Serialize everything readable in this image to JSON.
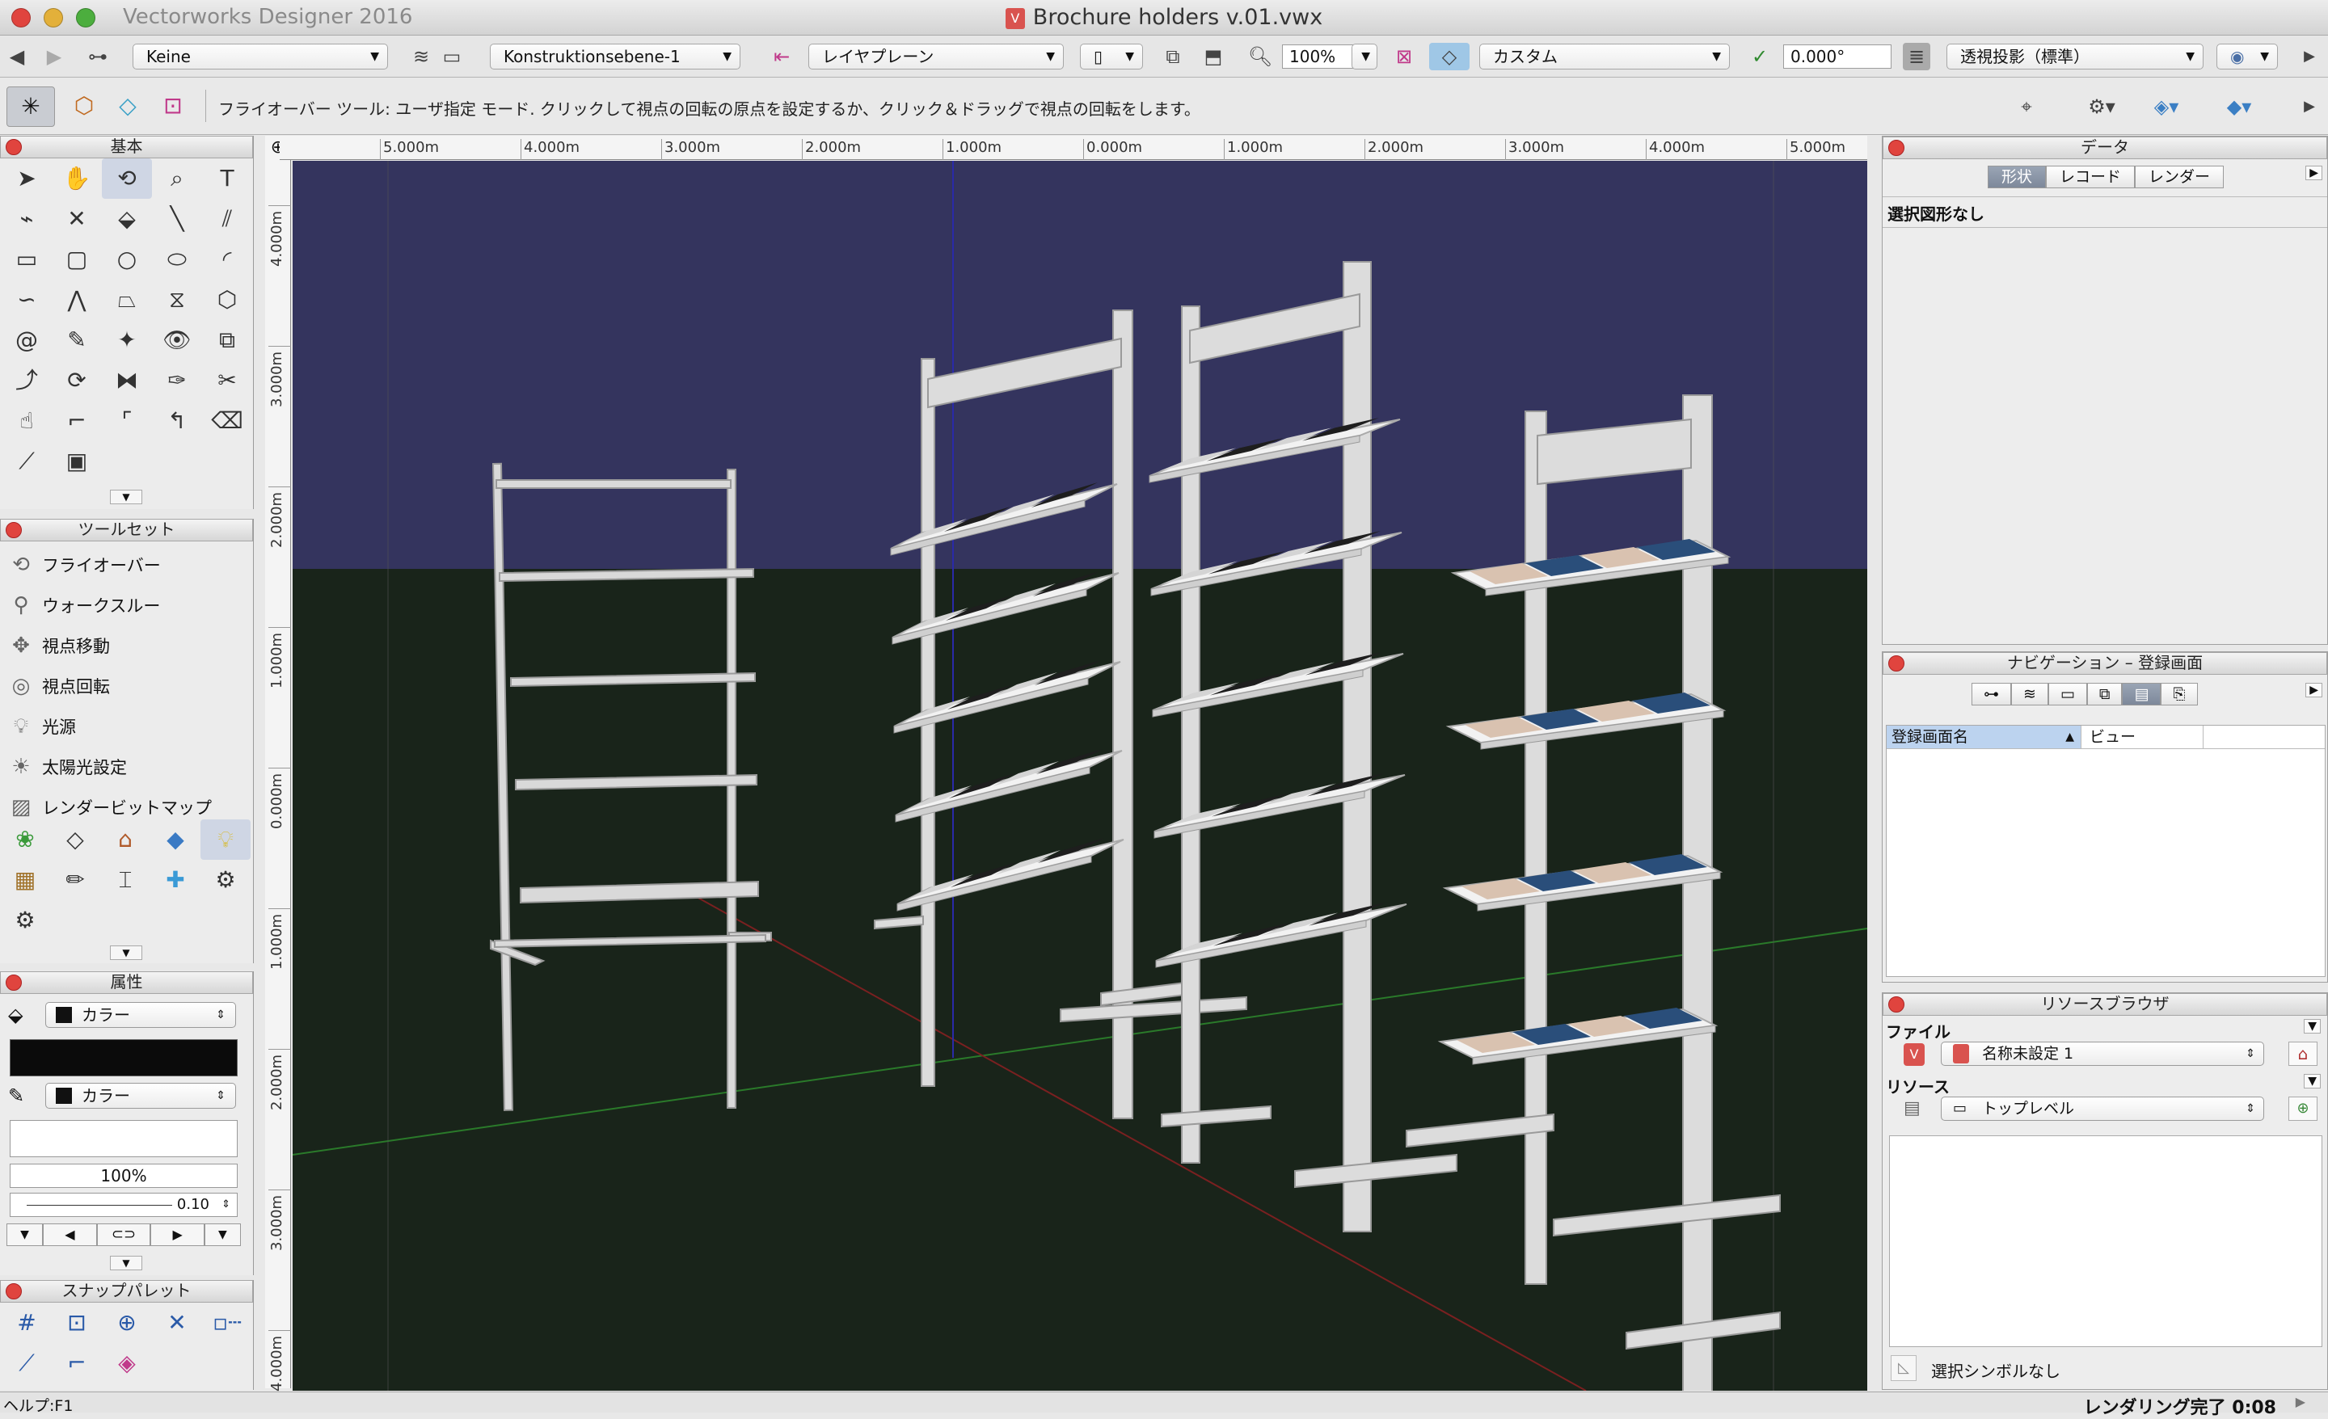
{
  "window": {
    "app_name": "Vectorworks Designer 2016",
    "doc_title": "Brochure holders v.01.vwx"
  },
  "view_bar": {
    "class_popup": "Keine",
    "layer_popup": "Konstruktionsebene-1",
    "plane_popup": "レイヤプレーン",
    "zoom_value": "100%",
    "view_popup": "カスタム",
    "angle_value": "0.000°",
    "projection_popup": "透視投影（標準）"
  },
  "mode_bar": {
    "message": "フライオーバー ツール: ユーザ指定 モード. クリックして視点の回転の原点を設定するか、クリック＆ドラッグで視点の回転をします。"
  },
  "palettes": {
    "basic": {
      "title": "基本"
    },
    "toolset": {
      "title": "ツールセット",
      "items": [
        {
          "label": "フライオーバー",
          "icon": "flyover-icon"
        },
        {
          "label": "ウォークスルー",
          "icon": "walkthrough-icon"
        },
        {
          "label": "視点移動",
          "icon": "translate-view-icon"
        },
        {
          "label": "視点回転",
          "icon": "rotate-view-icon"
        },
        {
          "label": "光源",
          "icon": "light-bulb-icon"
        },
        {
          "label": "太陽光設定",
          "icon": "sun-icon"
        },
        {
          "label": "レンダービットマップ",
          "icon": "render-bitmap-icon"
        }
      ]
    },
    "attributes": {
      "title": "属性",
      "fill_popup": "カラー",
      "pen_popup": "カラー",
      "opacity": "100%",
      "line_weight": "0.10"
    },
    "snap": {
      "title": "スナップパレット"
    }
  },
  "rulers": {
    "horizontal": [
      "5.000m",
      "4.000m",
      "3.000m",
      "2.000m",
      "1.000m",
      "0.000m",
      "1.000m",
      "2.000m",
      "3.000m",
      "4.000m",
      "5.000m"
    ],
    "vertical": [
      "4.000m",
      "3.000m",
      "2.000m",
      "1.000m",
      "0.000m",
      "1.000m",
      "2.000m",
      "3.000m",
      "4.000m"
    ]
  },
  "data_palette": {
    "title": "データ",
    "tabs": [
      "形状",
      "レコード",
      "レンダー"
    ],
    "active_tab": "形状",
    "selection_text": "選択図形なし"
  },
  "navigation_palette": {
    "title": "ナビゲーション – 登録画面",
    "col_name": "登録画面名",
    "col_view": "ビュー"
  },
  "resource_browser": {
    "title": "リソースブラウザ",
    "file_label": "ファイル",
    "file_popup": "名称未設定 1",
    "resource_label": "リソース",
    "resource_popup": "トップレベル",
    "no_symbol": "選択シンボルなし"
  },
  "status_bar": {
    "help": "ヘルプ:F1",
    "render_status": "レンダリング完了 0:08"
  },
  "colors": {
    "sky": "#34345e",
    "ground": "#19241a",
    "selection": "#bcd3ef"
  }
}
